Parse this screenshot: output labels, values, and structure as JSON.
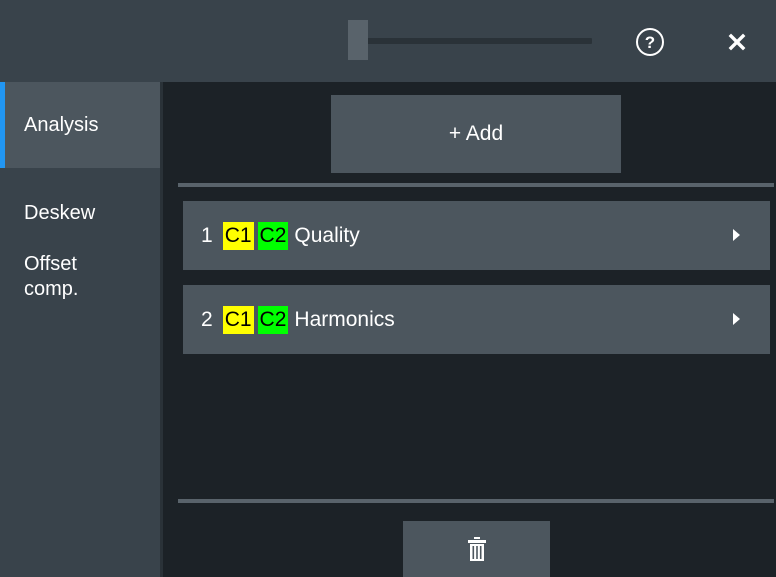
{
  "window": {
    "help_icon": "help-circle-icon",
    "help_glyph": "?",
    "close_icon": "close-icon"
  },
  "sidebar": {
    "items": [
      {
        "label": "Analysis",
        "active": true
      },
      {
        "label": "Deskew",
        "active": false
      },
      {
        "label": "Offset\ncomp.",
        "active": false
      }
    ]
  },
  "main": {
    "add_label": "+ Add",
    "rows": [
      {
        "number": "1",
        "chips": [
          "C1",
          "C2"
        ],
        "name": "Quality"
      },
      {
        "number": "2",
        "chips": [
          "C1",
          "C2"
        ],
        "name": "Harmonics"
      }
    ],
    "delete_icon": "trash-icon"
  },
  "colors": {
    "accent": "#2196f3",
    "chip_c1": "#ffff00",
    "chip_c2": "#00ff00",
    "panel": "#39434b",
    "button": "#4c565e",
    "background": "#1c2227"
  }
}
